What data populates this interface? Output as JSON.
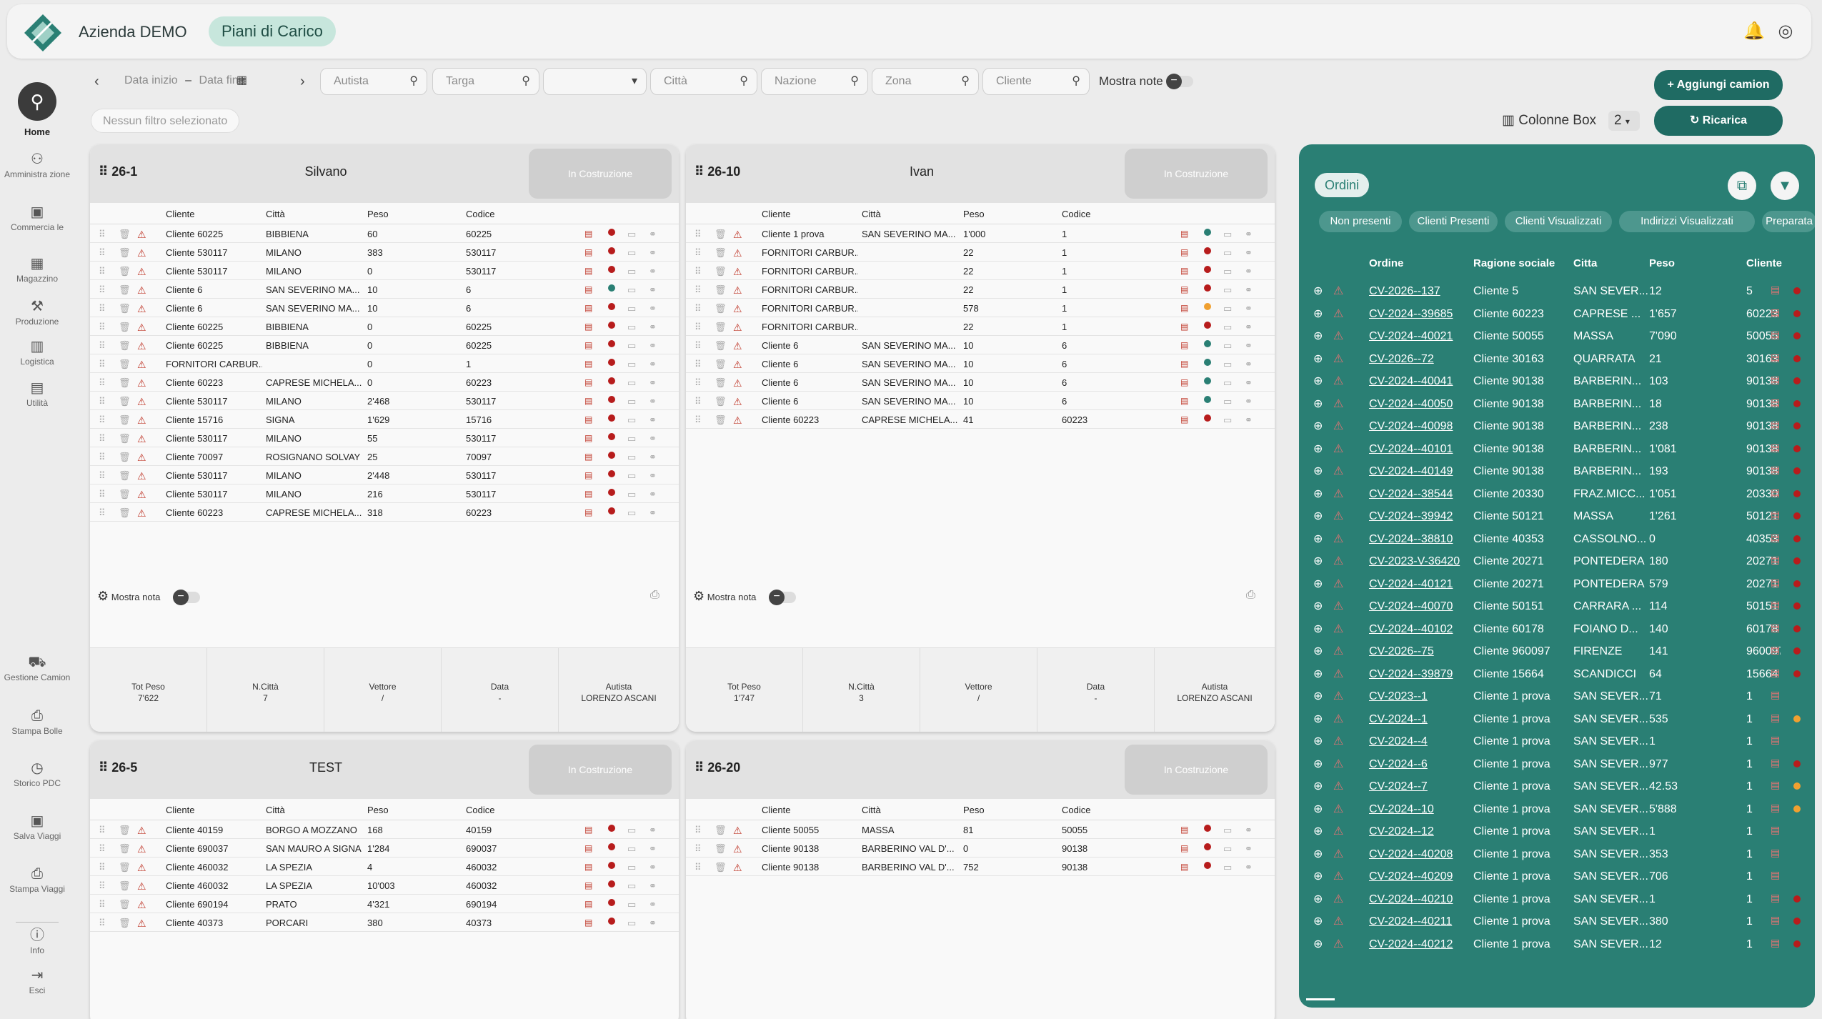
{
  "header": {
    "company": "Azienda DEMO",
    "page": "Piani di Carico"
  },
  "sidebar": {
    "home": "Home",
    "items": [
      "Amministra zione",
      "Commercia le",
      "Magazzino",
      "Produzione",
      "Logistica",
      "Utilità"
    ],
    "bottom": [
      "Gestione Camion",
      "Stampa Bolle",
      "Storico PDC",
      "Salva Viaggi",
      "Stampa Viaggi"
    ],
    "footer": [
      "Info",
      "Esci"
    ]
  },
  "filters": {
    "date_start": "Data inizio",
    "date_sep": "–",
    "date_end": "Data fine",
    "autista": "Autista",
    "targa": "Targa",
    "citta": "Città",
    "nazione": "Nazione",
    "zona": "Zona",
    "cliente": "Cliente",
    "mostra_note": "Mostra note",
    "no_filter": "Nessun filtro selezionato"
  },
  "actions": {
    "add_truck": "+ Aggiungi camion",
    "reload": "Ricarica",
    "columns_label": "Colonne Box",
    "columns_value": "2"
  },
  "columns": {
    "cliente": "Cliente",
    "citta": "Città",
    "peso": "Peso",
    "codice": "Codice"
  },
  "footer_labels": {
    "tot_peso": "Tot Peso",
    "n_citta": "N.Città",
    "vettore": "Vettore",
    "data": "Data",
    "autista": "Autista",
    "mostra_nota": "Mostra nota"
  },
  "panels": [
    {
      "code": "26-1",
      "name": "Silvano",
      "status": "In Costruzione",
      "rows": [
        [
          "Cliente 60225",
          "BIBBIENA",
          "60",
          "60225",
          "red"
        ],
        [
          "Cliente 530117",
          "MILANO",
          "383",
          "530117",
          "red"
        ],
        [
          "Cliente 530117",
          "MILANO",
          "0",
          "530117",
          "red"
        ],
        [
          "Cliente 6",
          "SAN SEVERINO MA...",
          "10",
          "6",
          "teal"
        ],
        [
          "Cliente 6",
          "SAN SEVERINO MA...",
          "10",
          "6",
          "red"
        ],
        [
          "Cliente 60225",
          "BIBBIENA",
          "0",
          "60225",
          "red"
        ],
        [
          "Cliente 60225",
          "BIBBIENA",
          "0",
          "60225",
          "red"
        ],
        [
          "FORNITORI CARBUR...",
          "",
          "0",
          "1",
          "red"
        ],
        [
          "Cliente 60223",
          "CAPRESE MICHELA...",
          "0",
          "60223",
          "red"
        ],
        [
          "Cliente 530117",
          "MILANO",
          "2'468",
          "530117",
          "red"
        ],
        [
          "Cliente 15716",
          "SIGNA",
          "1'629",
          "15716",
          "red"
        ],
        [
          "Cliente 530117",
          "MILANO",
          "55",
          "530117",
          "red"
        ],
        [
          "Cliente 70097",
          "ROSIGNANO SOLVAY",
          "25",
          "70097",
          "red"
        ],
        [
          "Cliente 530117",
          "MILANO",
          "2'448",
          "530117",
          "red"
        ],
        [
          "Cliente 530117",
          "MILANO",
          "216",
          "530117",
          "red"
        ],
        [
          "Cliente 60223",
          "CAPRESE MICHELA...",
          "318",
          "60223",
          "red"
        ]
      ],
      "tot_peso": "7'622",
      "n_citta": "7",
      "vettore": "/",
      "data": "-",
      "autista": "LORENZO ASCANI"
    },
    {
      "code": "26-10",
      "name": "Ivan",
      "status": "In Costruzione",
      "rows": [
        [
          "Cliente 1 prova",
          "SAN SEVERINO MA...",
          "1'000",
          "1",
          "teal"
        ],
        [
          "FORNITORI CARBUR...",
          "",
          "22",
          "1",
          "red"
        ],
        [
          "FORNITORI CARBUR...",
          "",
          "22",
          "1",
          "red"
        ],
        [
          "FORNITORI CARBUR...",
          "",
          "22",
          "1",
          "red"
        ],
        [
          "FORNITORI CARBUR...",
          "",
          "578",
          "1",
          "orange"
        ],
        [
          "FORNITORI CARBUR...",
          "",
          "22",
          "1",
          "red"
        ],
        [
          "Cliente 6",
          "SAN SEVERINO MA...",
          "10",
          "6",
          "teal"
        ],
        [
          "Cliente 6",
          "SAN SEVERINO MA...",
          "10",
          "6",
          "teal"
        ],
        [
          "Cliente 6",
          "SAN SEVERINO MA...",
          "10",
          "6",
          "teal"
        ],
        [
          "Cliente 6",
          "SAN SEVERINO MA...",
          "10",
          "6",
          "teal"
        ],
        [
          "Cliente 60223",
          "CAPRESE MICHELA...",
          "41",
          "60223",
          "red"
        ]
      ],
      "tot_peso": "1'747",
      "n_citta": "3",
      "vettore": "/",
      "data": "-",
      "autista": "LORENZO ASCANI"
    },
    {
      "code": "26-5",
      "name": "TEST",
      "status": "In Costruzione",
      "rows": [
        [
          "Cliente 40159",
          "BORGO A MOZZANO",
          "168",
          "40159",
          "red"
        ],
        [
          "Cliente 690037",
          "SAN MAURO A SIGNA",
          "1'284",
          "690037",
          "red"
        ],
        [
          "Cliente 460032",
          "LA SPEZIA",
          "4",
          "460032",
          "red"
        ],
        [
          "Cliente 460032",
          "LA SPEZIA",
          "10'003",
          "460032",
          "red"
        ],
        [
          "Cliente 690194",
          "PRATO",
          "4'321",
          "690194",
          "red"
        ],
        [
          "Cliente 40373",
          "PORCARI",
          "380",
          "40373",
          "red"
        ]
      ]
    },
    {
      "code": "26-20",
      "name": "",
      "status": "In Costruzione",
      "rows": [
        [
          "Cliente 50055",
          "MASSA",
          "81",
          "50055",
          "red"
        ],
        [
          "Cliente 90138",
          "BARBERINO VAL D'...",
          "0",
          "90138",
          "red"
        ],
        [
          "Cliente 90138",
          "BARBERINO VAL D'...",
          "752",
          "90138",
          "red"
        ]
      ]
    }
  ],
  "orders": {
    "title": "Ordini",
    "chips": [
      "Non presenti",
      "Clienti Presenti",
      "Clienti Visualizzati",
      "Indirizzi Visualizzati",
      "Preparata"
    ],
    "headers": [
      "Ordine",
      "Ragione sociale",
      "Citta",
      "Peso",
      "Cliente"
    ],
    "rows": [
      [
        "CV-2026--137",
        "Cliente 5",
        "SAN SEVER...",
        "12",
        "5",
        "red"
      ],
      [
        "CV-2024--39685",
        "Cliente 60223",
        "CAPRESE ...",
        "1'657",
        "60223",
        "red"
      ],
      [
        "CV-2024--40021",
        "Cliente 50055",
        "MASSA",
        "7'090",
        "50055",
        "red"
      ],
      [
        "CV-2026--72",
        "Cliente 30163",
        "QUARRATA",
        "21",
        "30163",
        "red"
      ],
      [
        "CV-2024--40041",
        "Cliente 90138",
        "BARBERIN...",
        "103",
        "90138",
        "red"
      ],
      [
        "CV-2024--40050",
        "Cliente 90138",
        "BARBERIN...",
        "18",
        "90138",
        "red"
      ],
      [
        "CV-2024--40098",
        "Cliente 90138",
        "BARBERIN...",
        "238",
        "90138",
        "red"
      ],
      [
        "CV-2024--40101",
        "Cliente 90138",
        "BARBERIN...",
        "1'081",
        "90138",
        "red"
      ],
      [
        "CV-2024--40149",
        "Cliente 90138",
        "BARBERIN...",
        "193",
        "90138",
        "red"
      ],
      [
        "CV-2024--38544",
        "Cliente 20330",
        "FRAZ.MICC...",
        "1'051",
        "20330",
        "red"
      ],
      [
        "CV-2024--39942",
        "Cliente 50121",
        "MASSA",
        "1'261",
        "50121",
        "red"
      ],
      [
        "CV-2024--38810",
        "Cliente 40353",
        "CASSOLNO...",
        "0",
        "40353",
        "red"
      ],
      [
        "CV-2023-V-36420",
        "Cliente 20271",
        "PONTEDERA",
        "180",
        "20271",
        "red"
      ],
      [
        "CV-2024--40121",
        "Cliente 20271",
        "PONTEDERA",
        "579",
        "20271",
        "red"
      ],
      [
        "CV-2024--40070",
        "Cliente 50151",
        "CARRARA ...",
        "114",
        "50151",
        "red"
      ],
      [
        "CV-2024--40102",
        "Cliente 60178",
        "FOIANO D...",
        "140",
        "60178",
        "red"
      ],
      [
        "CV-2026--75",
        "Cliente 960097",
        "FIRENZE",
        "141",
        "960097",
        "red"
      ],
      [
        "CV-2024--39879",
        "Cliente 15664",
        "SCANDICCI",
        "64",
        "15664",
        "red"
      ],
      [
        "CV-2023--1",
        "Cliente 1 prova",
        "SAN SEVER...",
        "71",
        "1",
        ""
      ],
      [
        "CV-2024--1",
        "Cliente 1 prova",
        "SAN SEVER...",
        "535",
        "1",
        "orange"
      ],
      [
        "CV-2024--4",
        "Cliente 1 prova",
        "SAN SEVER...",
        "1",
        "1",
        ""
      ],
      [
        "CV-2024--6",
        "Cliente 1 prova",
        "SAN SEVER...",
        "977",
        "1",
        "red"
      ],
      [
        "CV-2024--7",
        "Cliente 1 prova",
        "SAN SEVER...",
        "42.53",
        "1",
        "orange"
      ],
      [
        "CV-2024--10",
        "Cliente 1 prova",
        "SAN SEVER...",
        "5'888",
        "1",
        "orange"
      ],
      [
        "CV-2024--12",
        "Cliente 1 prova",
        "SAN SEVER...",
        "1",
        "1",
        ""
      ],
      [
        "CV-2024--40208",
        "Cliente 1 prova",
        "SAN SEVER...",
        "353",
        "1",
        ""
      ],
      [
        "CV-2024--40209",
        "Cliente 1 prova",
        "SAN SEVER...",
        "706",
        "1",
        ""
      ],
      [
        "CV-2024--40210",
        "Cliente 1 prova",
        "SAN SEVER...",
        "1",
        "1",
        "red"
      ],
      [
        "CV-2024--40211",
        "Cliente 1 prova",
        "SAN SEVER...",
        "380",
        "1",
        "red"
      ],
      [
        "CV-2024--40212",
        "Cliente 1 prova",
        "SAN SEVER...",
        "12",
        "1",
        "red"
      ]
    ]
  },
  "colors": {
    "accent": "#2a7f74",
    "red": "#b71c1c",
    "teal": "#2a7f74",
    "orange": "#f0a030"
  }
}
